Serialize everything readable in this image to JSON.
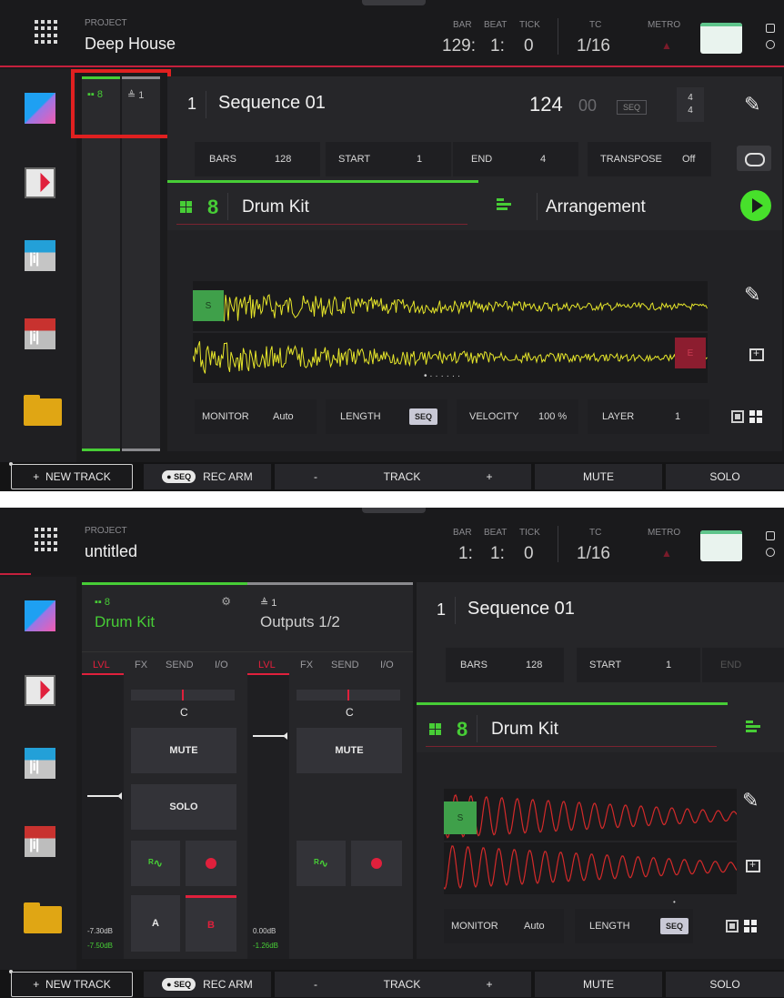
{
  "screen1": {
    "header": {
      "project_label": "PROJECT",
      "project_name": "Deep House",
      "bar_label": "BAR",
      "beat_label": "BEAT",
      "tick_label": "TICK",
      "bar": "129:",
      "beat": "1:",
      "tick": "0",
      "tc_label": "TC",
      "tc_value": "1/16",
      "metro_label": "METRO"
    },
    "strip_tabs": [
      {
        "label": "8",
        "icon": "pad-icon"
      },
      {
        "label": "1",
        "icon": "output-icon"
      }
    ],
    "sequence": {
      "number": "1",
      "name": "Sequence 01",
      "bpm": "124",
      "bpm_frac": "00",
      "seq_badge": "SEQ",
      "timesig_num": "4",
      "timesig_den": "4"
    },
    "fields": {
      "bars_label": "BARS",
      "bars": "128",
      "start_label": "START",
      "start": "1",
      "end_label": "END",
      "end": "4",
      "transpose_label": "TRANSPOSE",
      "transpose": "Off"
    },
    "track": {
      "number": "8",
      "name": "Drum Kit",
      "arrangement_label": "Arrangement"
    },
    "markers": {
      "start": "S",
      "end": "E"
    },
    "bottom_fields": {
      "monitor_label": "MONITOR",
      "monitor": "Auto",
      "length_label": "LENGTH",
      "length": "SEQ",
      "velocity_label": "VELOCITY",
      "velocity": "100 %",
      "layer_label": "LAYER",
      "layer": "1"
    }
  },
  "screen2": {
    "header": {
      "project_label": "PROJECT",
      "project_name": "untitled",
      "bar_label": "BAR",
      "beat_label": "BEAT",
      "tick_label": "TICK",
      "bar": "1:",
      "beat": "1:",
      "tick": "0",
      "tc_label": "TC",
      "tc_value": "1/16",
      "metro_label": "METRO"
    },
    "channels": [
      {
        "num": "8",
        "name": "Drum Kit",
        "tabs": [
          "LVL",
          "FX",
          "SEND",
          "I/O"
        ],
        "pan": "C",
        "mute": "MUTE",
        "solo": "SOLO",
        "a": "A",
        "b": "B",
        "db_main": "-7.30dB",
        "db_peak": "-7.50dB"
      },
      {
        "num": "1",
        "name": "Outputs 1/2",
        "tabs": [
          "LVL",
          "FX",
          "SEND",
          "I/O"
        ],
        "pan": "C",
        "mute": "MUTE",
        "db_main": "0.00dB",
        "db_peak": "-1.26dB"
      }
    ],
    "sequence": {
      "number": "1",
      "name": "Sequence 01"
    },
    "fields": {
      "bars_label": "BARS",
      "bars": "128",
      "start_label": "START",
      "start": "1",
      "end_label": "END"
    },
    "track": {
      "number": "8",
      "name": "Drum Kit"
    },
    "markers": {
      "start": "S"
    },
    "bottom_fields": {
      "monitor_label": "MONITOR",
      "monitor": "Auto",
      "length_label": "LENGTH",
      "length": "SEQ"
    }
  },
  "bottombar": {
    "new_track": "NEW TRACK",
    "seq_pill": "SEQ",
    "rec_arm": "REC ARM",
    "minus": "-",
    "track": "TRACK",
    "plus": "+",
    "mute": "MUTE",
    "solo": "SOLO"
  },
  "colors": {
    "accent_green": "#47cd36",
    "accent_red": "#e0203c",
    "waveform_yellow": "#e6e62a",
    "waveform_red": "#d42a2a",
    "highlight_box": "#e02020"
  }
}
